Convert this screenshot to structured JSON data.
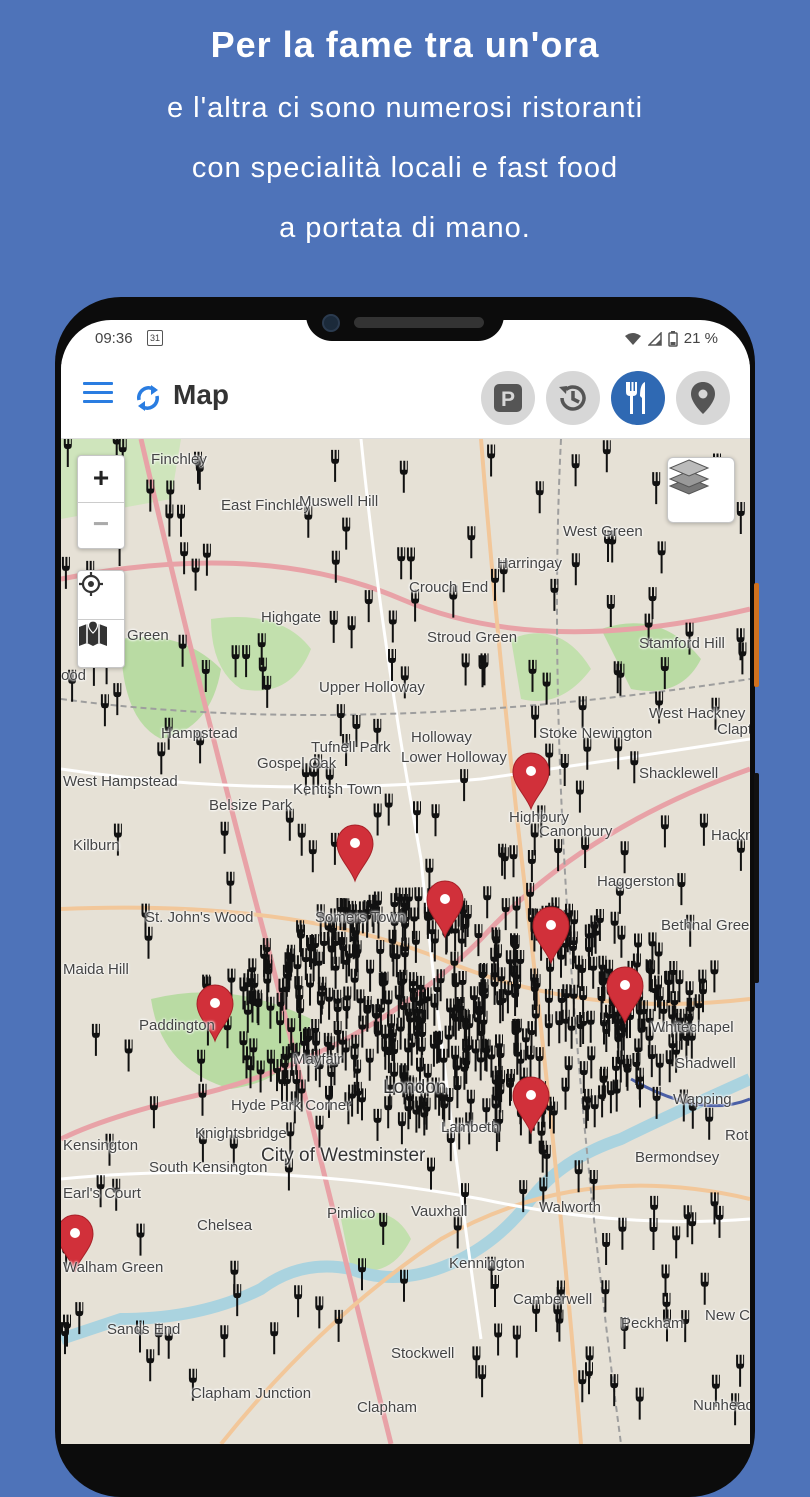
{
  "promo": {
    "headline": "Per la fame tra un'ora",
    "lines": [
      "e l'altra ci sono numerosi ristoranti",
      "con specialità locali e fast food",
      "a portata di mano."
    ]
  },
  "status_bar": {
    "time": "09:36",
    "calendar_day": "31",
    "battery": "21 %"
  },
  "app_bar": {
    "title": "Map",
    "buttons": [
      {
        "name": "parking",
        "label": "P",
        "active": false
      },
      {
        "name": "history",
        "active": false
      },
      {
        "name": "restaurants",
        "active": true
      },
      {
        "name": "location",
        "active": false
      }
    ]
  },
  "map": {
    "zoom_in": "+",
    "zoom_out": "−",
    "places": [
      "Finchley",
      "East Finchley",
      "Muswell Hill",
      "West Green",
      "Harringay",
      "Crouch End",
      "Highgate",
      "Stroud Green",
      "Stamford Hill",
      "Upper Holloway",
      "Hampstead",
      "Holloway",
      "Lower Holloway",
      "Stoke Newington",
      "Gospel Oak",
      "Tufnell Park",
      "West Hackney",
      "Clapton",
      "West Hampstead",
      "Kentish Town",
      "Shacklewell",
      "Belsize Park",
      "Highbury",
      "Canonbury",
      "Hackney",
      "Kilburn",
      "Haggerston",
      "St. John's Wood",
      "Somers Town",
      "Maida Hill",
      "Paddington",
      "Bethnal Green",
      "Mayfair",
      "London",
      "Whitechapel",
      "Shadwell",
      "Wapping",
      "Hyde Park Corner",
      "Kensington",
      "Knightsbridge",
      "City of Westminster",
      "South Kensington",
      "Lambeth",
      "Bermondsey",
      "Earl's Court",
      "Chelsea",
      "Pimlico",
      "Vauxhall",
      "Walworth",
      "Kennington",
      "Walham Green",
      "Camberwell",
      "Peckham",
      "New Cross",
      "Sands End",
      "Stockwell",
      "Clapham Junction",
      "Clapham",
      "Nunhead",
      "Green",
      "ood",
      "Rot"
    ]
  }
}
